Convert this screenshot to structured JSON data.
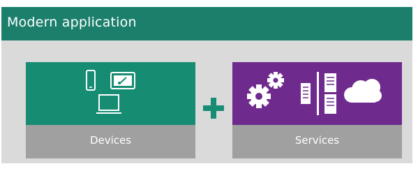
{
  "header": {
    "title": "Modern application"
  },
  "tiles": [
    {
      "label": "Devices"
    },
    {
      "label": "Services"
    }
  ],
  "colors": {
    "header": "#1b7f6c",
    "devices": "#168c73",
    "services": "#6e2a8c",
    "label_bar": "#a0a0a0",
    "plus": "#168c73",
    "background": "#dadada"
  },
  "icons": {
    "devices": [
      "phone-icon",
      "tablet-icon",
      "laptop-icon"
    ],
    "services": [
      "gears-icon",
      "server-icon",
      "divider",
      "server-icon",
      "cloud-icon"
    ],
    "connector": "plus-icon"
  }
}
